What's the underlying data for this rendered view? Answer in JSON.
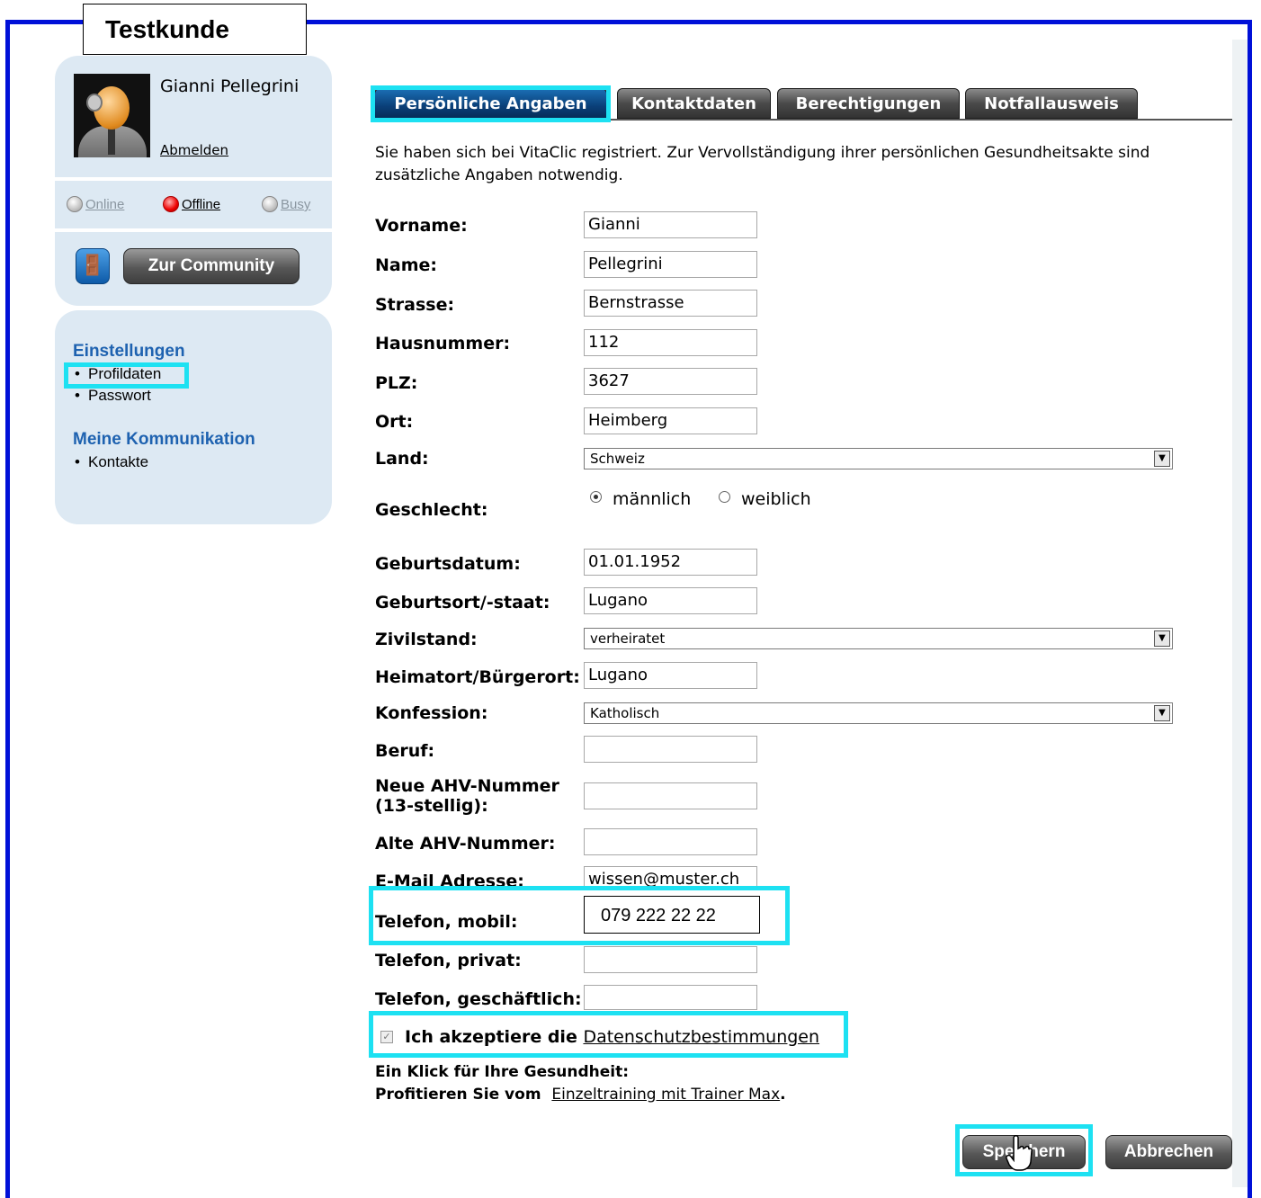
{
  "customer_label": "Testkunde",
  "user": {
    "name": "Gianni Pellegrini",
    "logout": "Abmelden"
  },
  "status": {
    "online": "Online",
    "offline": "Offline",
    "busy": "Busy"
  },
  "community": {
    "button": "Zur Community",
    "icon": "door-exit-icon"
  },
  "menu": {
    "settings_head": "Einstellungen",
    "settings_items": [
      "Profildaten",
      "Passwort"
    ],
    "comm_head": "Meine Kommunikation",
    "comm_items": [
      "Kontakte"
    ]
  },
  "tabs": [
    {
      "label": "Persönliche Angaben",
      "active": true
    },
    {
      "label": "Kontaktdaten",
      "active": false
    },
    {
      "label": "Berechtigungen",
      "active": false
    },
    {
      "label": "Notfallausweis",
      "active": false
    }
  ],
  "intro": "Sie haben sich bei VitaClic registriert. Zur Vervollständigung ihrer persönlichen Gesundheitsakte sind zusätzliche Angaben notwendig.",
  "form": {
    "vorname": {
      "label": "Vorname:",
      "value": "Gianni"
    },
    "name": {
      "label": "Name:",
      "value": "Pellegrini"
    },
    "strasse": {
      "label": "Strasse:",
      "value": "Bernstrasse"
    },
    "hausnummer": {
      "label": "Hausnummer:",
      "value": "112"
    },
    "plz": {
      "label": "PLZ:",
      "value": "3627"
    },
    "ort": {
      "label": "Ort:",
      "value": "Heimberg"
    },
    "land": {
      "label": "Land:",
      "value": "Schweiz"
    },
    "geschlecht": {
      "label": "Geschlecht:",
      "option_m": "männlich",
      "option_w": "weiblich",
      "selected": "männlich"
    },
    "geburtsdatum": {
      "label": "Geburtsdatum:",
      "value": "01.01.1952"
    },
    "geburtsort": {
      "label": "Geburtsort/-staat:",
      "value": "Lugano"
    },
    "zivilstand": {
      "label": "Zivilstand:",
      "value": "verheiratet"
    },
    "heimatort": {
      "label": "Heimatort/Bürgerort:",
      "value": "Lugano"
    },
    "konfession": {
      "label": "Konfession:",
      "value": "Katholisch"
    },
    "beruf": {
      "label": "Beruf:",
      "value": ""
    },
    "ahv_neu": {
      "label_1": "Neue AHV-Nummer",
      "label_2": "(13-stellig):",
      "value": ""
    },
    "ahv_alt": {
      "label": "Alte AHV-Nummer:",
      "value": ""
    },
    "email": {
      "label": "E-Mail Adresse:",
      "value": "wissen@muster.ch"
    },
    "mobil": {
      "label": "Telefon, mobil:",
      "value": "079 222 22 22"
    },
    "privat": {
      "label": "Telefon, privat:",
      "value": ""
    },
    "geschaeftlich": {
      "label": "Telefon, geschäftlich:",
      "value": ""
    }
  },
  "privacy": {
    "text": "Ich akzeptiere die",
    "link": "Datenschutzbestimmungen",
    "checked": true
  },
  "promo": {
    "line1": "Ein Klick für Ihre Gesundheit:",
    "line2_prefix": "Profitieren Sie vom",
    "link": "Einzeltraining mit Trainer Max",
    "suffix": "."
  },
  "buttons": {
    "save": "Speichern",
    "cancel": "Abbrechen"
  },
  "colors": {
    "frame": "#0010d8",
    "highlight": "#1de1f2",
    "active_tab": "#0a3f78",
    "menu_head": "#1e62b0",
    "panel": "#dde9f3"
  }
}
